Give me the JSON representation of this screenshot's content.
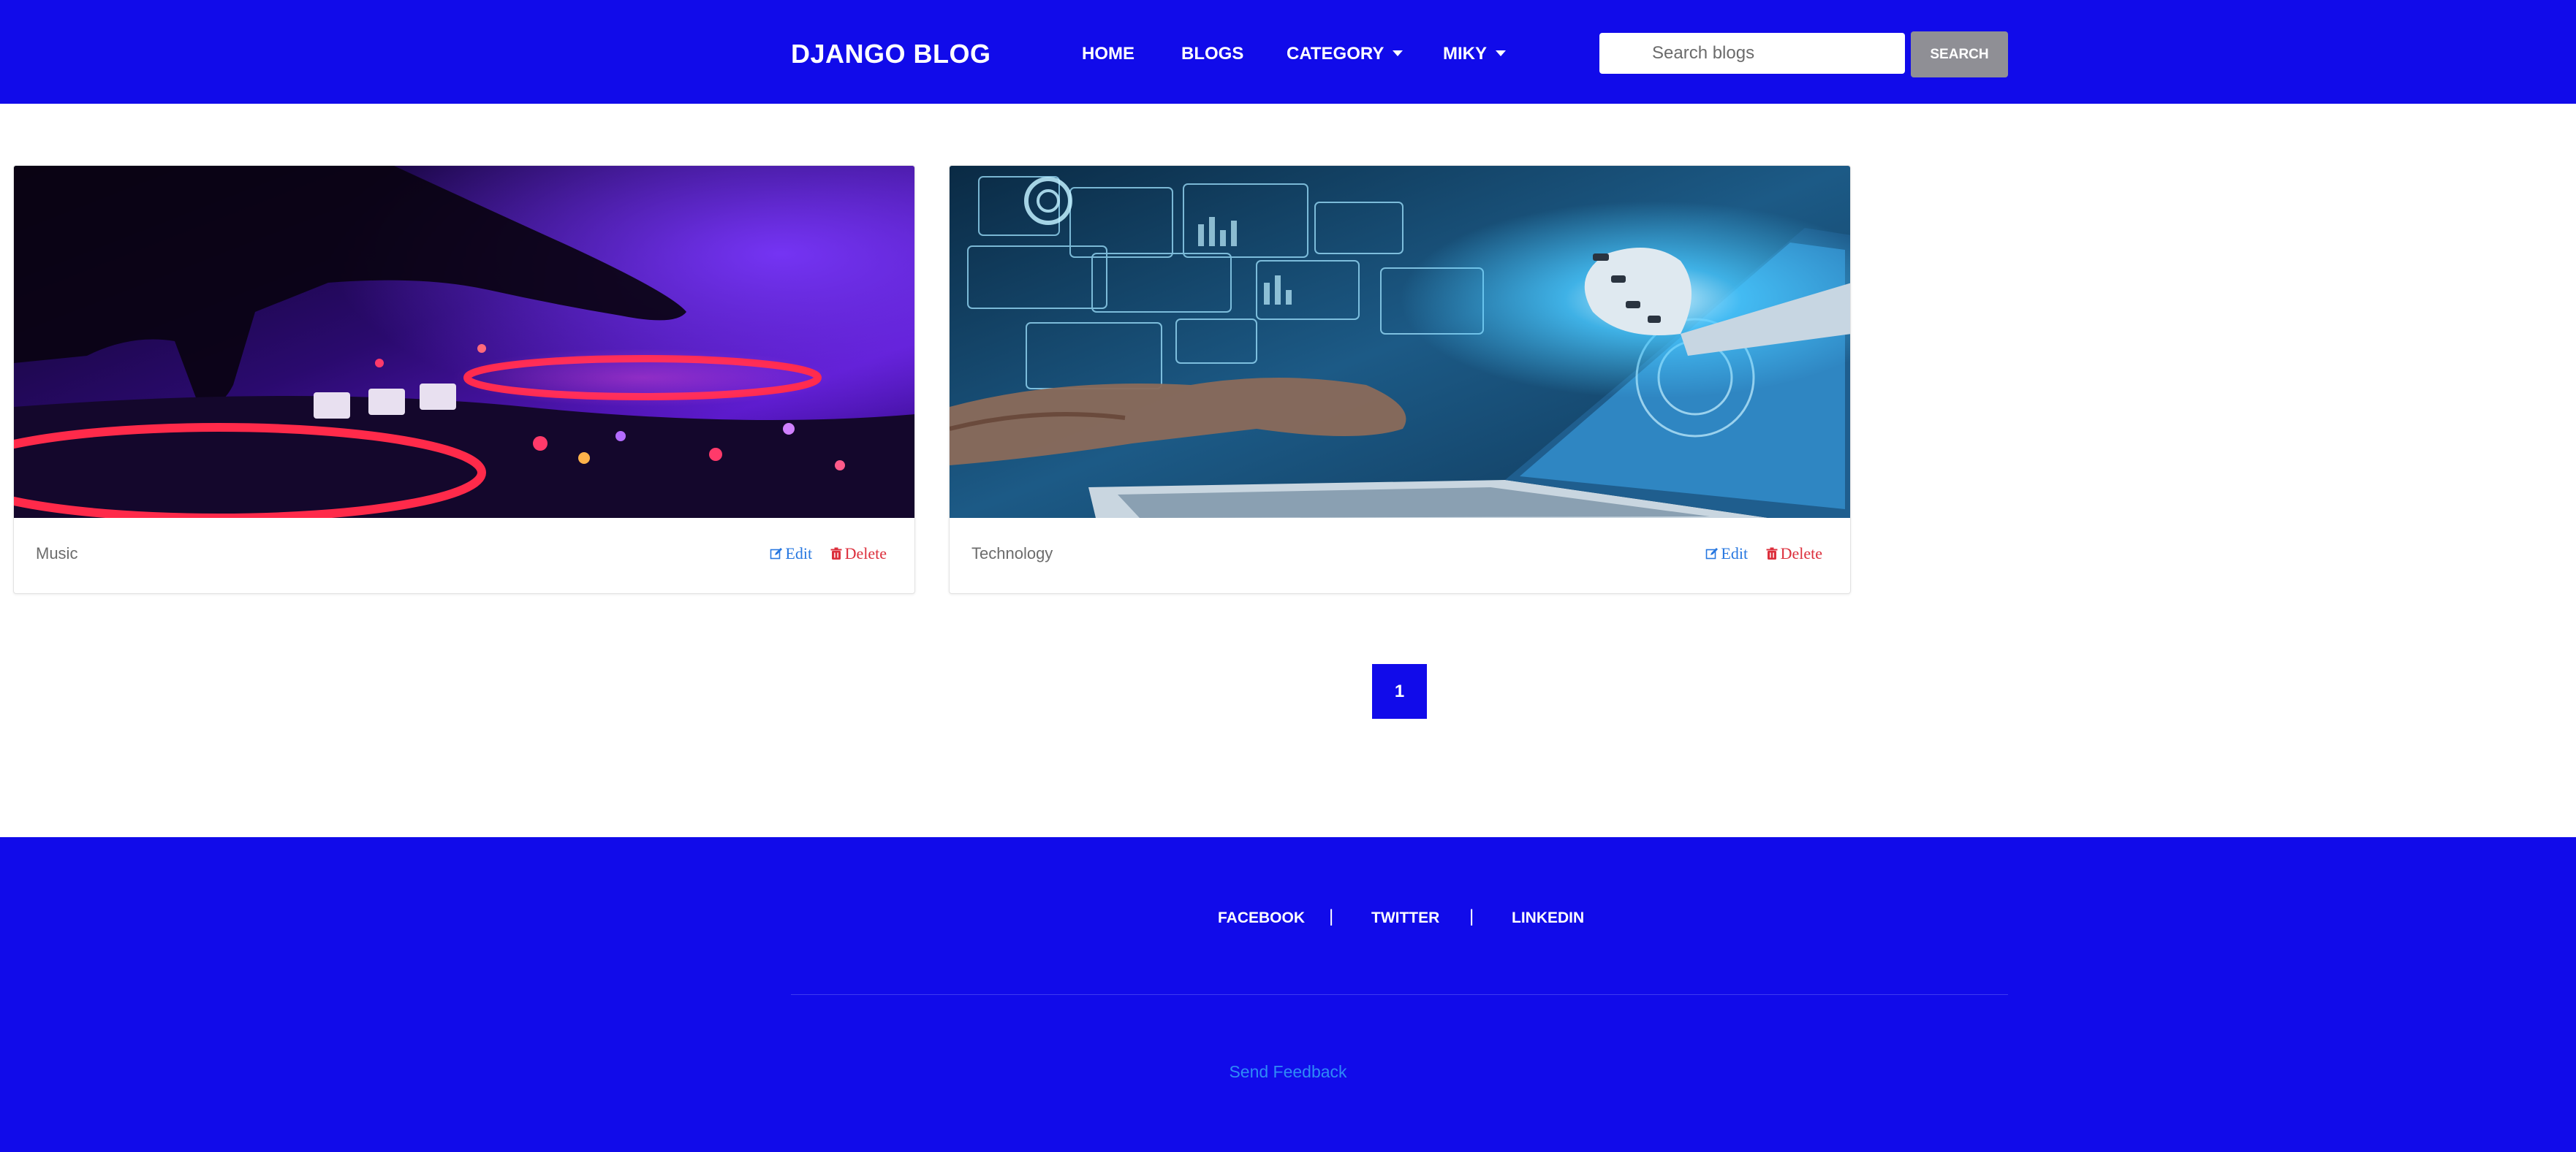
{
  "navbar": {
    "brand": "DJANGO BLOG",
    "links": [
      "HOME",
      "BLOGS",
      "CATEGORY",
      "MIKY"
    ],
    "search_placeholder": "Search blogs",
    "search_button": "SEARCH",
    "background": "#110bea"
  },
  "cards": [
    {
      "category": "Music",
      "edit_label": "Edit",
      "delete_label": "Delete",
      "image": "dj-turntable-purple"
    },
    {
      "category": "Technology",
      "edit_label": "Edit",
      "delete_label": "Delete",
      "image": "robot-hand-laptop"
    }
  ],
  "pagination": {
    "current": "1"
  },
  "footer": {
    "links": [
      "FACEBOOK",
      "TWITTER",
      "LINKEDIN"
    ],
    "separator": "|",
    "feedback": "Send Feedback"
  },
  "colors": {
    "primary": "#110bea",
    "edit": "#2677e0",
    "delete": "#dc2f3c",
    "search_button": "#8f8f95",
    "feedback": "#2f8bf6"
  }
}
